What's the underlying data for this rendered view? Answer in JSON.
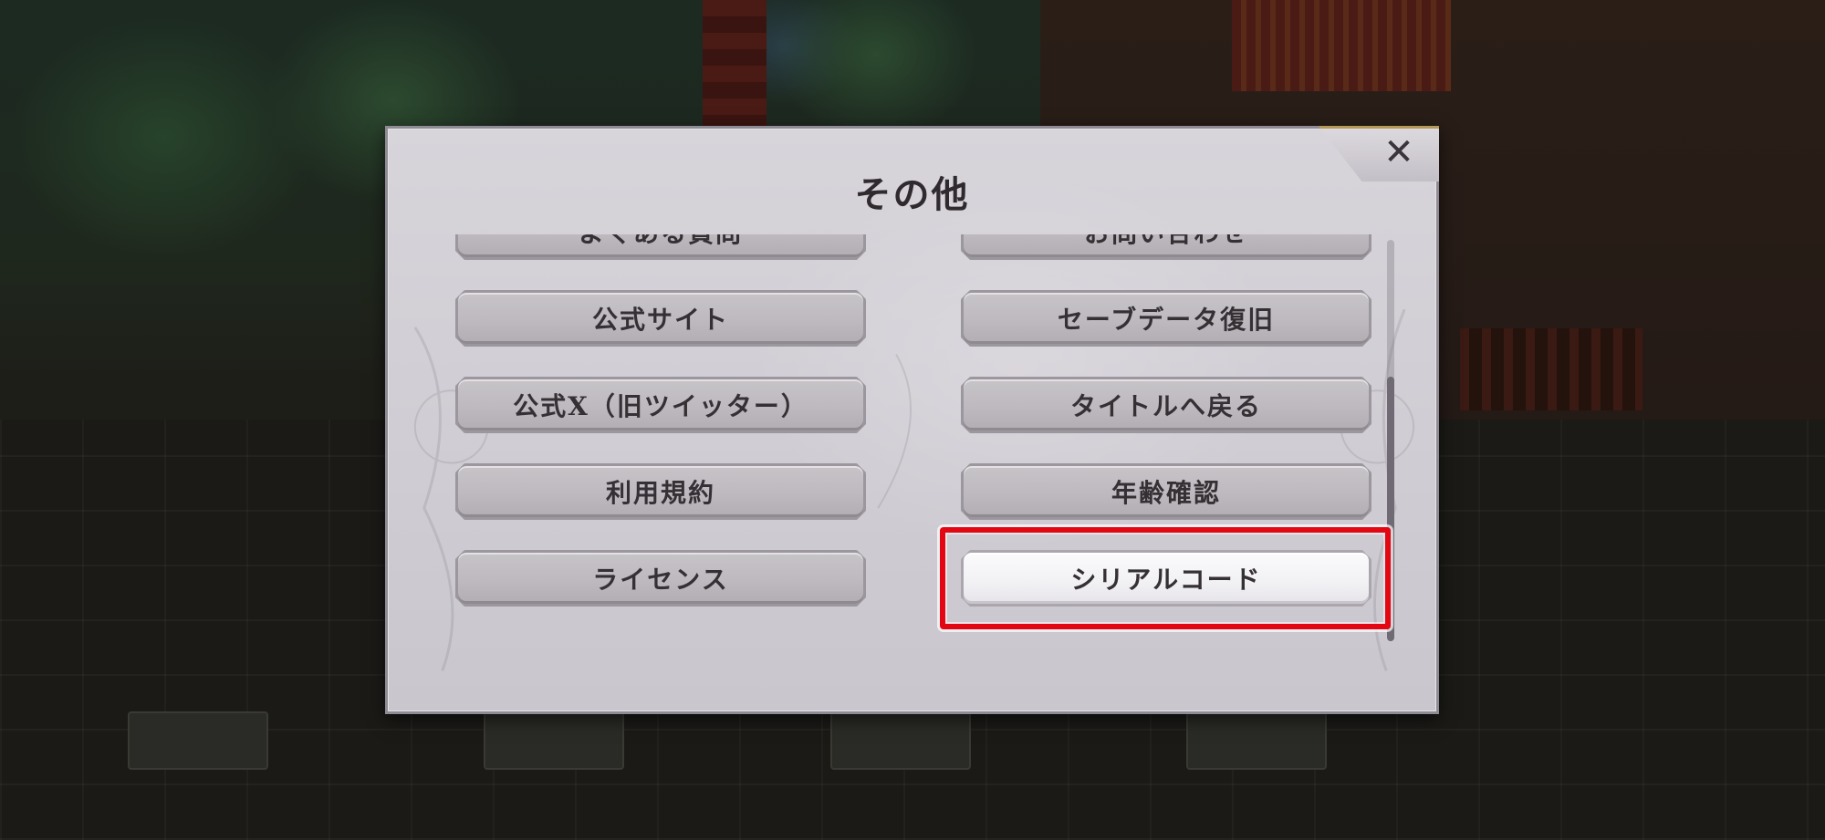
{
  "dialog": {
    "title": "その他",
    "close_label": "✕"
  },
  "menu": {
    "items": [
      {
        "label": "よくある質問",
        "selected": false
      },
      {
        "label": "お問い合わせ",
        "selected": false
      },
      {
        "label": "公式サイト",
        "selected": false
      },
      {
        "label": "セーブデータ復旧",
        "selected": false
      },
      {
        "label": "公式X（旧ツイッター）",
        "selected": false
      },
      {
        "label": "タイトルへ戻る",
        "selected": false
      },
      {
        "label": "利用規約",
        "selected": false
      },
      {
        "label": "年齢確認",
        "selected": false
      },
      {
        "label": "ライセンス",
        "selected": false
      },
      {
        "label": "シリアルコード",
        "selected": true
      }
    ]
  },
  "scroll": {
    "position_fraction": 0.34,
    "visible_fraction": 0.66
  },
  "colors": {
    "highlight": "#e30613",
    "dialog_bg": "#d2cfd6",
    "button_bg": "#bfbbc1",
    "button_selected_bg": "#f4f3f6"
  }
}
